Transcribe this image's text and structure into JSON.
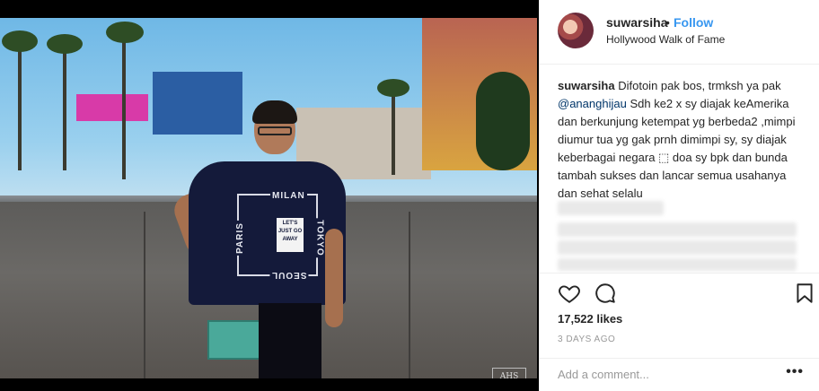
{
  "post": {
    "username": "suwarsiha",
    "separator": "•",
    "follow_label": "Follow",
    "location": "Hollywood Walk of Fame",
    "caption_user": "suwarsiha",
    "caption_part1": "Difotoin pak bos, trmksh ya pak",
    "mention": "@ananghijau",
    "caption_part2": "Sdh ke2 x sy diajak keAmerika dan berkunjung ketempat yg berbeda2 ,mimpi diumur tua yg gak prnh dimimpi sy, sy diajak keberbagai negara ⬚ doa sy bpk dan bunda tambah sukses dan lancar semua usahanya dan sehat selalu",
    "likes": "17,522 likes",
    "timestamp": "3 DAYS AGO",
    "comment_placeholder": "Add a comment...",
    "more_label": "•••"
  },
  "photo": {
    "shirt_text": {
      "top": "MILAN",
      "left": "PARIS",
      "right": "TOKYO",
      "bottom": "SEOUL",
      "label": "LET'S JUST GO AWAY"
    },
    "watermark": "AHS"
  },
  "colors": {
    "accent": "#3897f0",
    "text": "#262626",
    "muted": "#999999"
  },
  "icons": [
    "heart-icon",
    "comment-icon",
    "bookmark-icon",
    "more-options-icon"
  ]
}
